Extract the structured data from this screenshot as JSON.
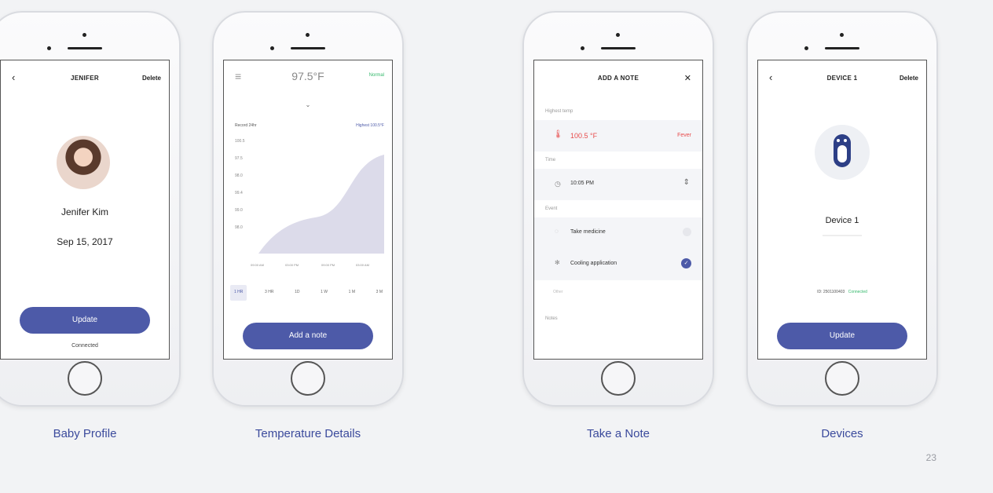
{
  "screens": [
    {
      "caption": "Baby Profile",
      "header": {
        "back": "‹",
        "title": "JENIFER",
        "action": "Delete"
      },
      "name": "Jenifer Kim",
      "date": "Sep 15, 2017",
      "primary_button": "Update",
      "secondary_link": "Connected"
    },
    {
      "caption": "Temperature Details",
      "header": {
        "menu": "≡",
        "temperature": "97.5°F",
        "status": "Normal"
      },
      "chart": {
        "legend_left": "Record 24hr",
        "legend_right": "Highest 100.5°F",
        "y_ticks": [
          "100.5",
          "97.5",
          "98.0",
          "99.4",
          "99.0",
          "98.0"
        ],
        "x_ticks": [
          "09:00 AM",
          "03:00 PM",
          "09:00 PM",
          "03:00 AM"
        ],
        "range_tabs": [
          "1 HR",
          "3 HR",
          "1D",
          "1 W",
          "1 M",
          "3 M"
        ],
        "selected_range": "1 HR"
      },
      "primary_button": "Add a note"
    },
    {
      "caption": "Take a Note",
      "header": {
        "title": "ADD A NOTE",
        "close": "✕"
      },
      "sections": {
        "temp_label": "Highest temp",
        "temp_value": "100.5 °F",
        "temp_status": "Fever",
        "time_label": "Time",
        "time_value": "10:05 PM",
        "event_label": "Event",
        "event1": "Take medicine",
        "event2": "Cooling application",
        "other": "Other",
        "notes_label": "Notes"
      }
    },
    {
      "caption": "Devices",
      "header": {
        "back": "‹",
        "title": "DEVICE 1",
        "action": "Delete"
      },
      "device_name": "Device 1",
      "device_id": "ID: 2501100403",
      "device_status": "Connected",
      "primary_button": "Update"
    }
  ],
  "page_number": "23",
  "colors": {
    "accent": "#4d5aa8",
    "alert": "#e84b4b",
    "ok": "#32b86a"
  }
}
